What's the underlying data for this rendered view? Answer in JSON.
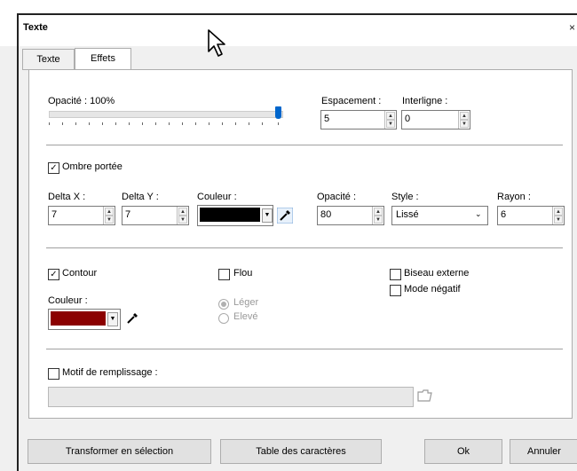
{
  "window": {
    "title": "Texte",
    "close_glyph": "×"
  },
  "tabs": [
    {
      "label": "Texte"
    },
    {
      "label": "Effets"
    }
  ],
  "text_block": {
    "opacity_label": "Opacité : 100%",
    "opacity_percent": 100,
    "spacing_label": "Espacement :",
    "spacing_value": "5",
    "line_spacing_label": "Interligne :",
    "line_spacing_value": "0"
  },
  "shadow": {
    "checkbox_label": "Ombre portée",
    "checked": true,
    "delta_x_label": "Delta X :",
    "delta_x_value": "7",
    "delta_y_label": "Delta Y :",
    "delta_y_value": "7",
    "color_label": "Couleur :",
    "color": "#000000",
    "opacity_label": "Opacité :",
    "opacity_value": "80",
    "style_label": "Style :",
    "style_value": "Lissé",
    "radius_label": "Rayon :",
    "radius_value": "6"
  },
  "outline": {
    "checkbox_label": "Contour",
    "checked": true,
    "color_label": "Couleur :",
    "color": "#8b0000"
  },
  "blur": {
    "checkbox_label": "Flou",
    "checked": false,
    "options": [
      {
        "label": "Léger",
        "selected": true
      },
      {
        "label": "Elevé",
        "selected": false
      }
    ]
  },
  "bevel": {
    "label": "Biseau externe",
    "checked": false
  },
  "negative": {
    "label": "Mode négatif",
    "checked": false
  },
  "fill_pattern": {
    "checkbox_label": "Motif de remplissage :",
    "checked": false,
    "value": ""
  },
  "buttons": {
    "to_selection": "Transformer en sélection",
    "char_table": "Table des caractères",
    "ok": "Ok",
    "cancel": "Annuler"
  },
  "colors": {
    "accent": "#0066cc"
  }
}
